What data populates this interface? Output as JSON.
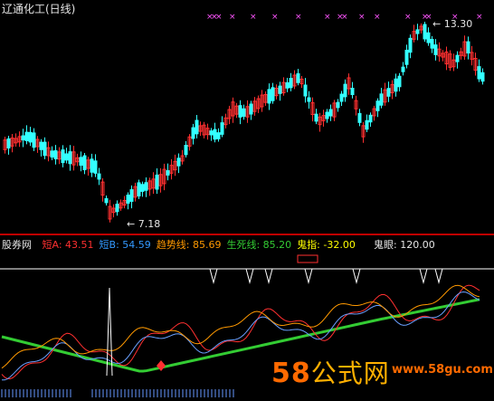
{
  "title": "辽通化工(日线)",
  "price_high_label": "13.30",
  "price_low_label": "7.18",
  "indicator": {
    "name": "股券网",
    "fields": [
      {
        "label": "短A:",
        "value": "43.51",
        "color": "#ff3030"
      },
      {
        "label": "短B:",
        "value": "54.59",
        "color": "#3399ff"
      },
      {
        "label": "趋势线:",
        "value": "85.69",
        "color": "#ff9900"
      },
      {
        "label": "生死线:",
        "value": "85.20",
        "color": "#33cc33"
      },
      {
        "label": "鬼指:",
        "value": "-32.00",
        "color": "#ffff00"
      }
    ],
    "ghost_eye_label": "鬼眼:",
    "ghost_eye_value": "120.00"
  },
  "watermark": {
    "brand_num": "58",
    "brand_cn": "公式网",
    "site": "www.58gu.com"
  },
  "colors": {
    "up": "#ff3030",
    "down": "#33ffff",
    "bg": "#000000",
    "divider": "#c00000"
  }
}
